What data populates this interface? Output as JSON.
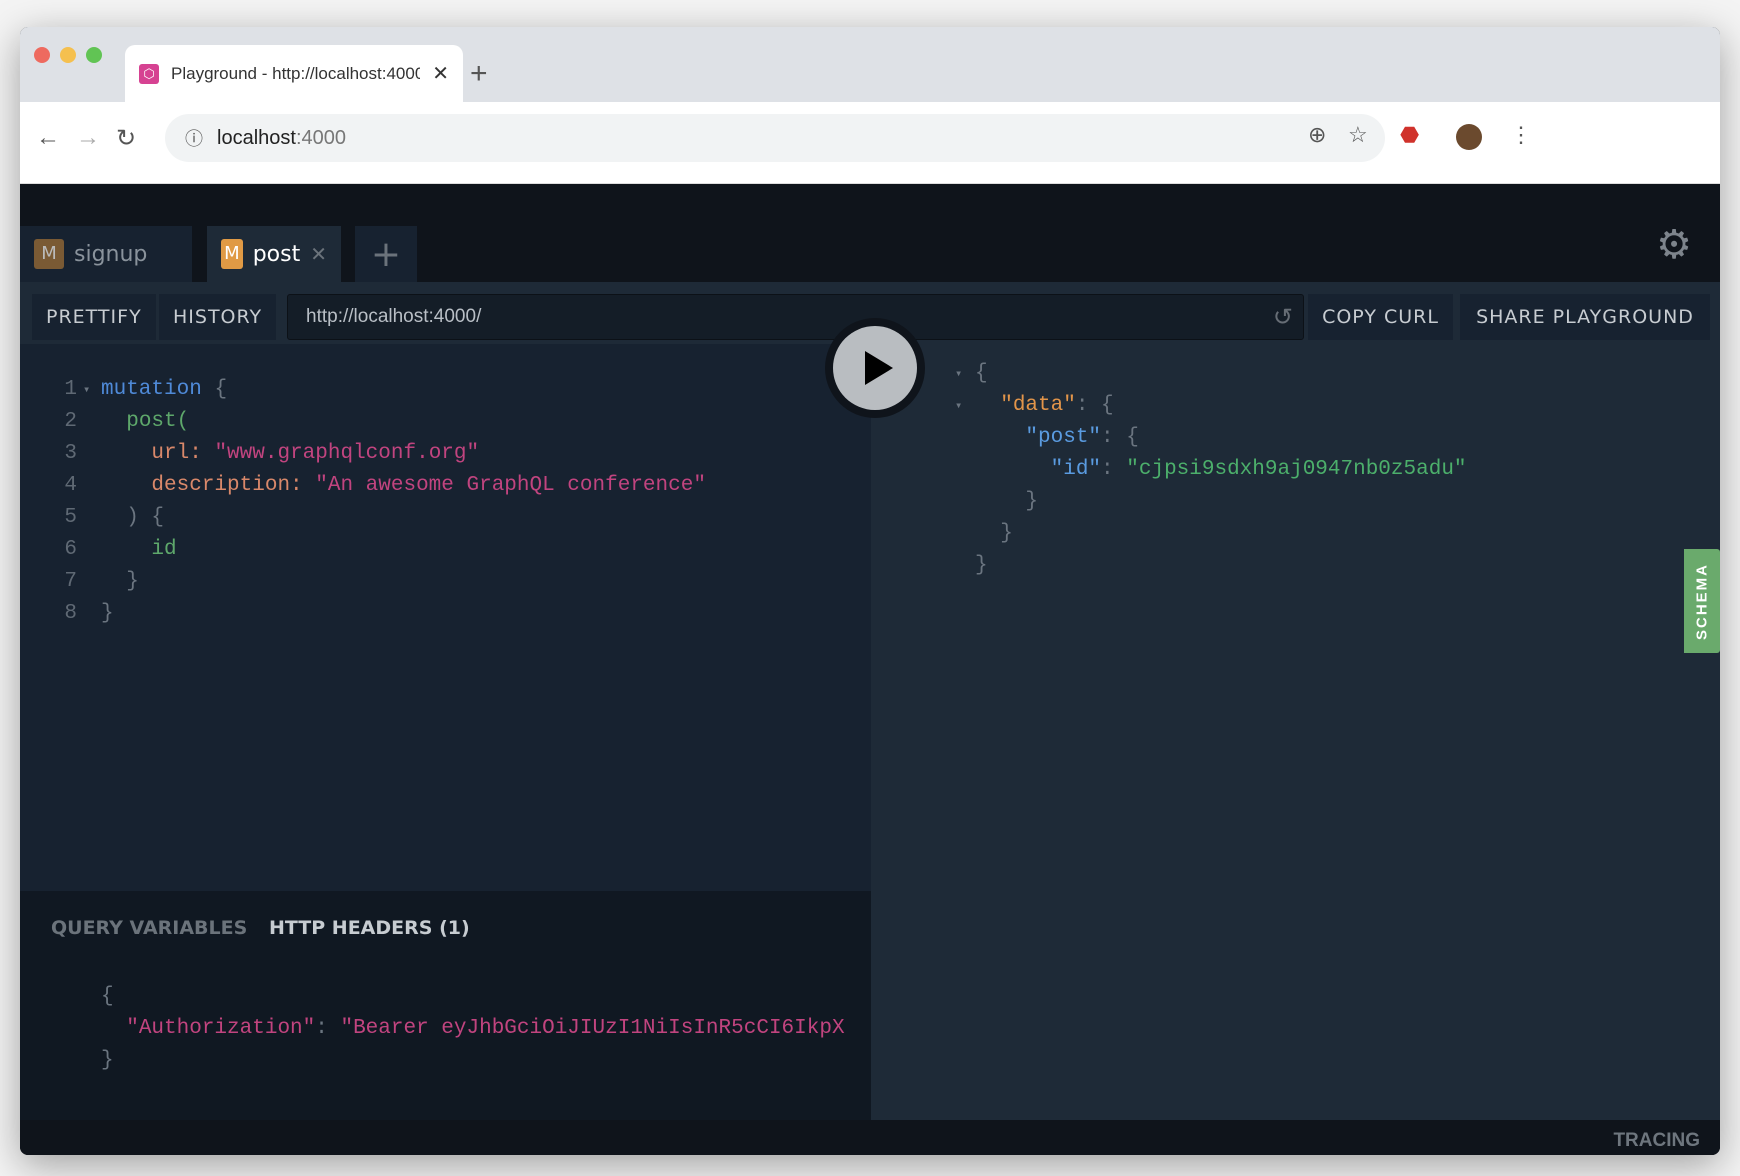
{
  "browser": {
    "tab_title": "Playground - http://localhost:4000",
    "address_host": "localhost",
    "address_port": ":4000",
    "favicon": "graphql-icon"
  },
  "tabs": [
    {
      "badge": "M",
      "label": "signup"
    },
    {
      "badge": "M",
      "label": "post"
    }
  ],
  "toolbar": {
    "prettify": "PRETTIFY",
    "history": "HISTORY",
    "endpoint": "http://localhost:4000/",
    "copy_curl": "COPY CURL",
    "share": "SHARE PLAYGROUND"
  },
  "query": {
    "lines": [
      "mutation",
      "{",
      "post(",
      "url:",
      "\"www.graphqlconf.org\"",
      "description:",
      "\"An awesome GraphQL conference\"",
      ") {",
      "id",
      "}",
      "}"
    ]
  },
  "result": {
    "data_key": "\"data\"",
    "post_key": "\"post\"",
    "id_key": "\"id\"",
    "id_value": "\"cjpsi9sdxh9aj0947nb0z5adu\""
  },
  "schema_label": "SCHEMA",
  "bottom": {
    "query_variables": "QUERY VARIABLES",
    "http_headers": "HTTP HEADERS (1)",
    "header_key": "\"Authorization\"",
    "header_value": "\"Bearer eyJhbGciOiJIUzI1NiIsInR5cCI6IkpX"
  },
  "tracing": "TRACING",
  "colors": {
    "accent_schema": "#6aaa6c",
    "badge_active": "#e09a45",
    "badge_inactive": "#7a5a34"
  }
}
